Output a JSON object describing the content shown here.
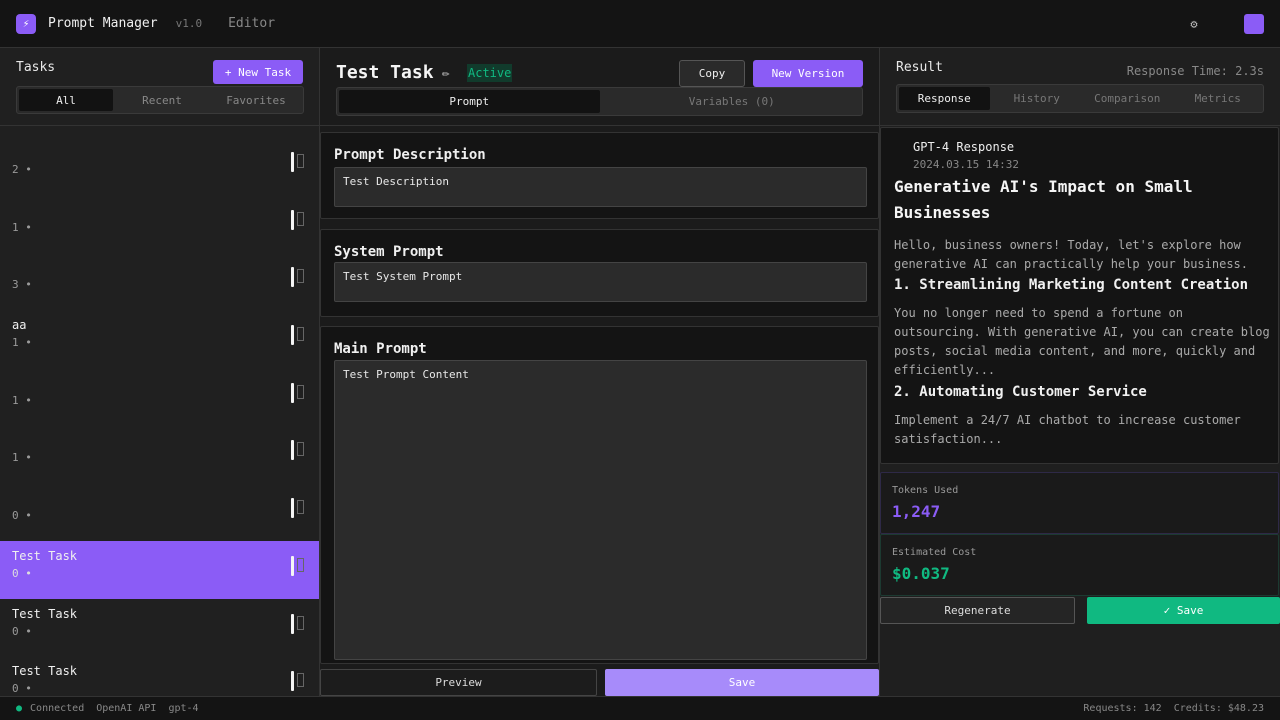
{
  "header": {
    "logo_icon": "⚡",
    "app_title": "Prompt Manager",
    "version": "v1.0",
    "mode": "Editor",
    "icons": [
      "",
      "⚙",
      "",
      ""
    ]
  },
  "tasks_panel": {
    "title": "Tasks",
    "new_task_label": "+ New Task",
    "filters": [
      "All",
      "Recent",
      "Favorites"
    ],
    "items": [
      {
        "icon": "",
        "title": "  ",
        "meta": "2  •   "
      },
      {
        "icon": "",
        "title": "  ",
        "meta": "1  •   "
      },
      {
        "icon": "",
        "title": "",
        "meta": "3  •   "
      },
      {
        "icon": "",
        "title": "aa",
        "meta": "1  •   "
      },
      {
        "icon": "",
        "title": "",
        "meta": "1  •   "
      },
      {
        "icon": "",
        "title": "",
        "meta": "1  •   "
      },
      {
        "icon": "",
        "title": "",
        "meta": "0  •   "
      },
      {
        "icon": "",
        "title": "Test Task",
        "meta": "0  •   "
      },
      {
        "icon": "",
        "title": "Test Task",
        "meta": "0  •   "
      },
      {
        "icon": "",
        "title": "Test Task",
        "meta": "0  •   "
      }
    ]
  },
  "editor": {
    "task_name": "Test Task",
    "edit_icon": "✏",
    "status": "Active",
    "copy_label": " Copy",
    "new_version_label": " New Version",
    "tabs": [
      "Prompt",
      "Variables (0)"
    ],
    "description": {
      "title": " Prompt Description",
      "value": "Test Description"
    },
    "system": {
      "title": " System Prompt",
      "value": "Test System Prompt"
    },
    "main": {
      "title": " Main Prompt",
      "value": "Test Prompt Content"
    },
    "preview_label": " Preview",
    "save_label": " Save"
  },
  "result": {
    "title": "Result",
    "response_time": "Response Time: 2.3s",
    "tabs": [
      "Response",
      "History",
      "Comparison",
      "Metrics"
    ],
    "model_icon": "",
    "model_name": "GPT-4 Response",
    "model_time": "2024.03.15 14:32",
    "heading": "Generative AI's Impact on Small Businesses",
    "intro": "Hello, business owners! Today, let's explore how generative AI can practically help your business.",
    "section1_title": "1. Streamlining Marketing Content Creation",
    "section1_body": "You no longer need to spend a fortune on outsourcing. With generative AI, you can create blog posts, social media content, and more, quickly and efficiently...",
    "section2_title": "2. Automating Customer Service",
    "section2_body": "Implement a 24/7 AI chatbot to increase customer satisfaction...",
    "tokens_label": "Tokens Used",
    "tokens_value": "1,247",
    "cost_label": "Estimated Cost",
    "cost_value": "$0.037",
    "regenerate_label": " Regenerate",
    "save_label": "✓ Save"
  },
  "statusbar": {
    "dot": "●",
    "connection": "Connected",
    "provider": "OpenAI API",
    "model": "gpt-4",
    "requests": "Requests: 142",
    "credits": "Credits: $48.23"
  },
  "colors": {
    "accent": "#8b5cf6",
    "success": "#10b981",
    "background": "#1f1f1f"
  }
}
